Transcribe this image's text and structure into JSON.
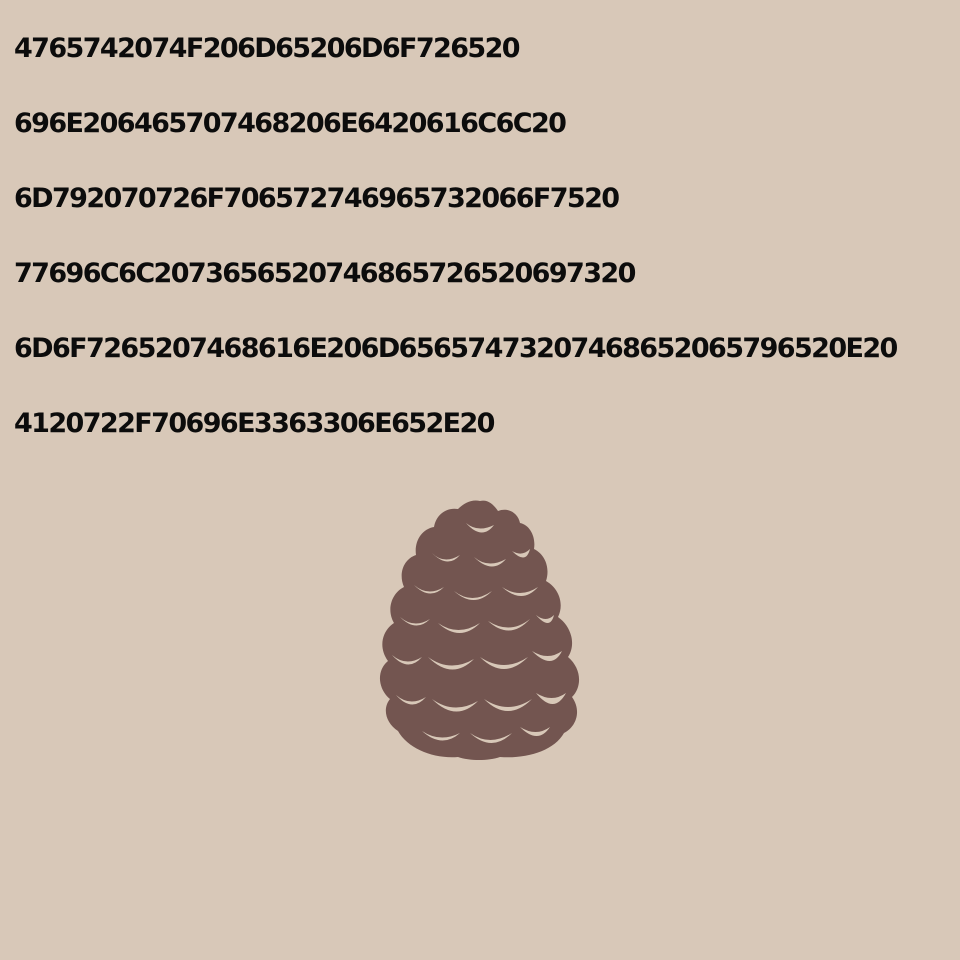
{
  "lines": [
    "4765742074F206D65206D6F726520",
    "696E206465707468206E6420616C6C20",
    "6D792070726F706572746965732066F7520",
    "77696C6C2073656520746865726520697320",
    "6D6F7265207468616E206D65657473207468652065796520E20",
    "4120722F70696E3363306E652E20"
  ],
  "illustration": {
    "icon": "pinecone-icon",
    "fill": "#735550",
    "scale_fill": "#d8c8b8"
  },
  "colors": {
    "background": "#d8c8b8",
    "text": "#0c0c0c"
  }
}
